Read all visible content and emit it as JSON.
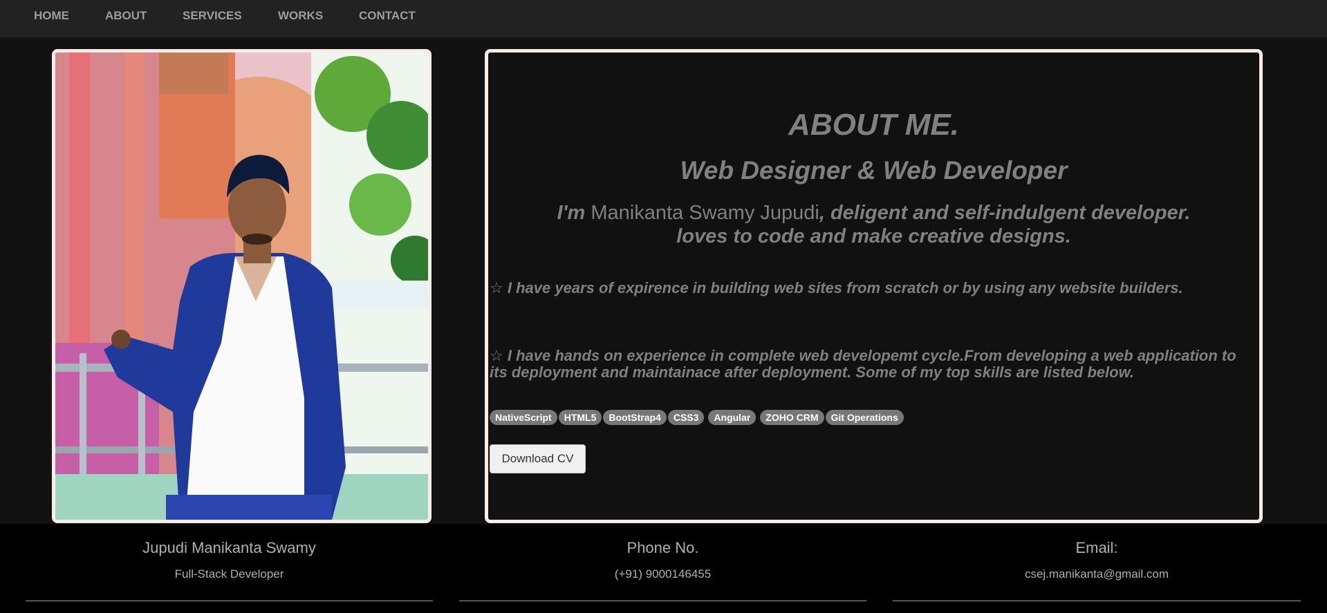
{
  "nav": {
    "items": [
      "HOME",
      "ABOUT",
      "SERVICES",
      "WORKS",
      "CONTACT"
    ]
  },
  "about": {
    "title": "ABOUT ME.",
    "subtitle": "Web Designer & Web Developer",
    "intro_prefix": "I'm",
    "name": "Manikanta Swamy Jupudi",
    "intro_suffix": ", deligent and self-indulgent developer.",
    "intro_line2": "loves to code and make creative designs.",
    "point1": "I have years of expirence in building web sites from scratch or by using any website builders.",
    "point2": "I have hands on experience in complete web developemt cycle.From developing a web application to its deployment and maintainace after deployment. Some of my top skills are listed below.",
    "star": "☆",
    "skills": [
      "NativeScript",
      "HTML5",
      "BootStrap4",
      "CSS3",
      "Angular",
      "ZOHO CRM",
      "Git Operations"
    ],
    "download_label": "Download CV"
  },
  "footer": {
    "name": "Jupudi Manikanta Swamy",
    "role": "Full-Stack Developer",
    "phone_label": "Phone No.",
    "phone": "(+91) 9000146455",
    "email_label": "Email:",
    "email": "csej.manikanta@gmail.com"
  },
  "colors": {
    "background": "#121212",
    "navbar": "#222222",
    "nav_text": "#9d9d9d",
    "card_border": "#f7ece8",
    "text_gray": "#808080",
    "badge": "#777777",
    "footer": "#000000"
  }
}
